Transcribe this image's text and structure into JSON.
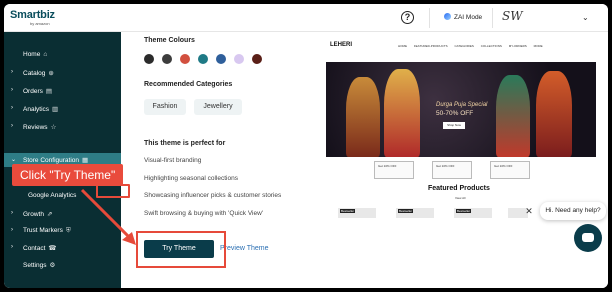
{
  "topbar": {
    "logo_text": "Smartbiz",
    "logo_sub": "by amazon",
    "help_icon": "?",
    "zai_label": "ZAI Mode",
    "brand_mark": "SW",
    "chevron": "⌄"
  },
  "sidebar": {
    "items": [
      {
        "label": "Home",
        "icon": "⌂",
        "arrow": ""
      },
      {
        "label": "Catalog",
        "icon": "⊕",
        "arrow": "›"
      },
      {
        "label": "Orders",
        "icon": "▤",
        "arrow": "›"
      },
      {
        "label": "Analytics",
        "icon": "▥",
        "arrow": "›"
      },
      {
        "label": "Reviews",
        "icon": "☆",
        "arrow": "›"
      },
      {
        "label": "Store Configuration",
        "icon": "▦",
        "arrow": "⌄"
      },
      {
        "label": "Google Analytics",
        "icon": "",
        "arrow": ""
      },
      {
        "label": "Growth",
        "icon": "⇗",
        "arrow": "›"
      },
      {
        "label": "Trust Markers",
        "icon": "⛨",
        "arrow": "›"
      },
      {
        "label": "Contact",
        "icon": "☎",
        "arrow": "›"
      },
      {
        "label": "Settings",
        "icon": "⚙",
        "arrow": ""
      }
    ]
  },
  "main": {
    "colours_title": "Theme Colours",
    "colours": [
      "#2b2b2b",
      "#3d3d3d",
      "#d2503f",
      "#1f7a86",
      "#2f5f9b",
      "#d8c8f0",
      "#5a1f17"
    ],
    "categories_title": "Recommended Categories",
    "categories": [
      "Fashion",
      "Jewellery"
    ],
    "perfect_title": "This theme is perfect for",
    "perfect_items": [
      "Visual-first branding",
      "Highlighting seasonal collections",
      "Showcasing influencer picks & customer stories",
      "Swift browsing & buying with 'Quick View'"
    ],
    "try_label": "Try Theme",
    "preview_label": "Preview Theme"
  },
  "preview": {
    "logo": "LEHERI",
    "menu": "HOME FEATURED-PRODUCTS CATEGORIES COLLECTIONS MY-ORDERS MORE",
    "hero_title": "Durga Puja Special",
    "hero_offer": "50-70% OFF",
    "hero_cta": "Shop Now",
    "coupons": [
      "Get 10% OFF",
      "Get 10% OFF",
      "Get 10% OFF"
    ],
    "featured_title": "Featured Products",
    "view_all": "View All",
    "product_badge": "Bestseller"
  },
  "chat": {
    "close": "✕",
    "bubble": "Hi. Need any help?"
  },
  "annotation": {
    "callout": "Click \"Try Theme\""
  }
}
